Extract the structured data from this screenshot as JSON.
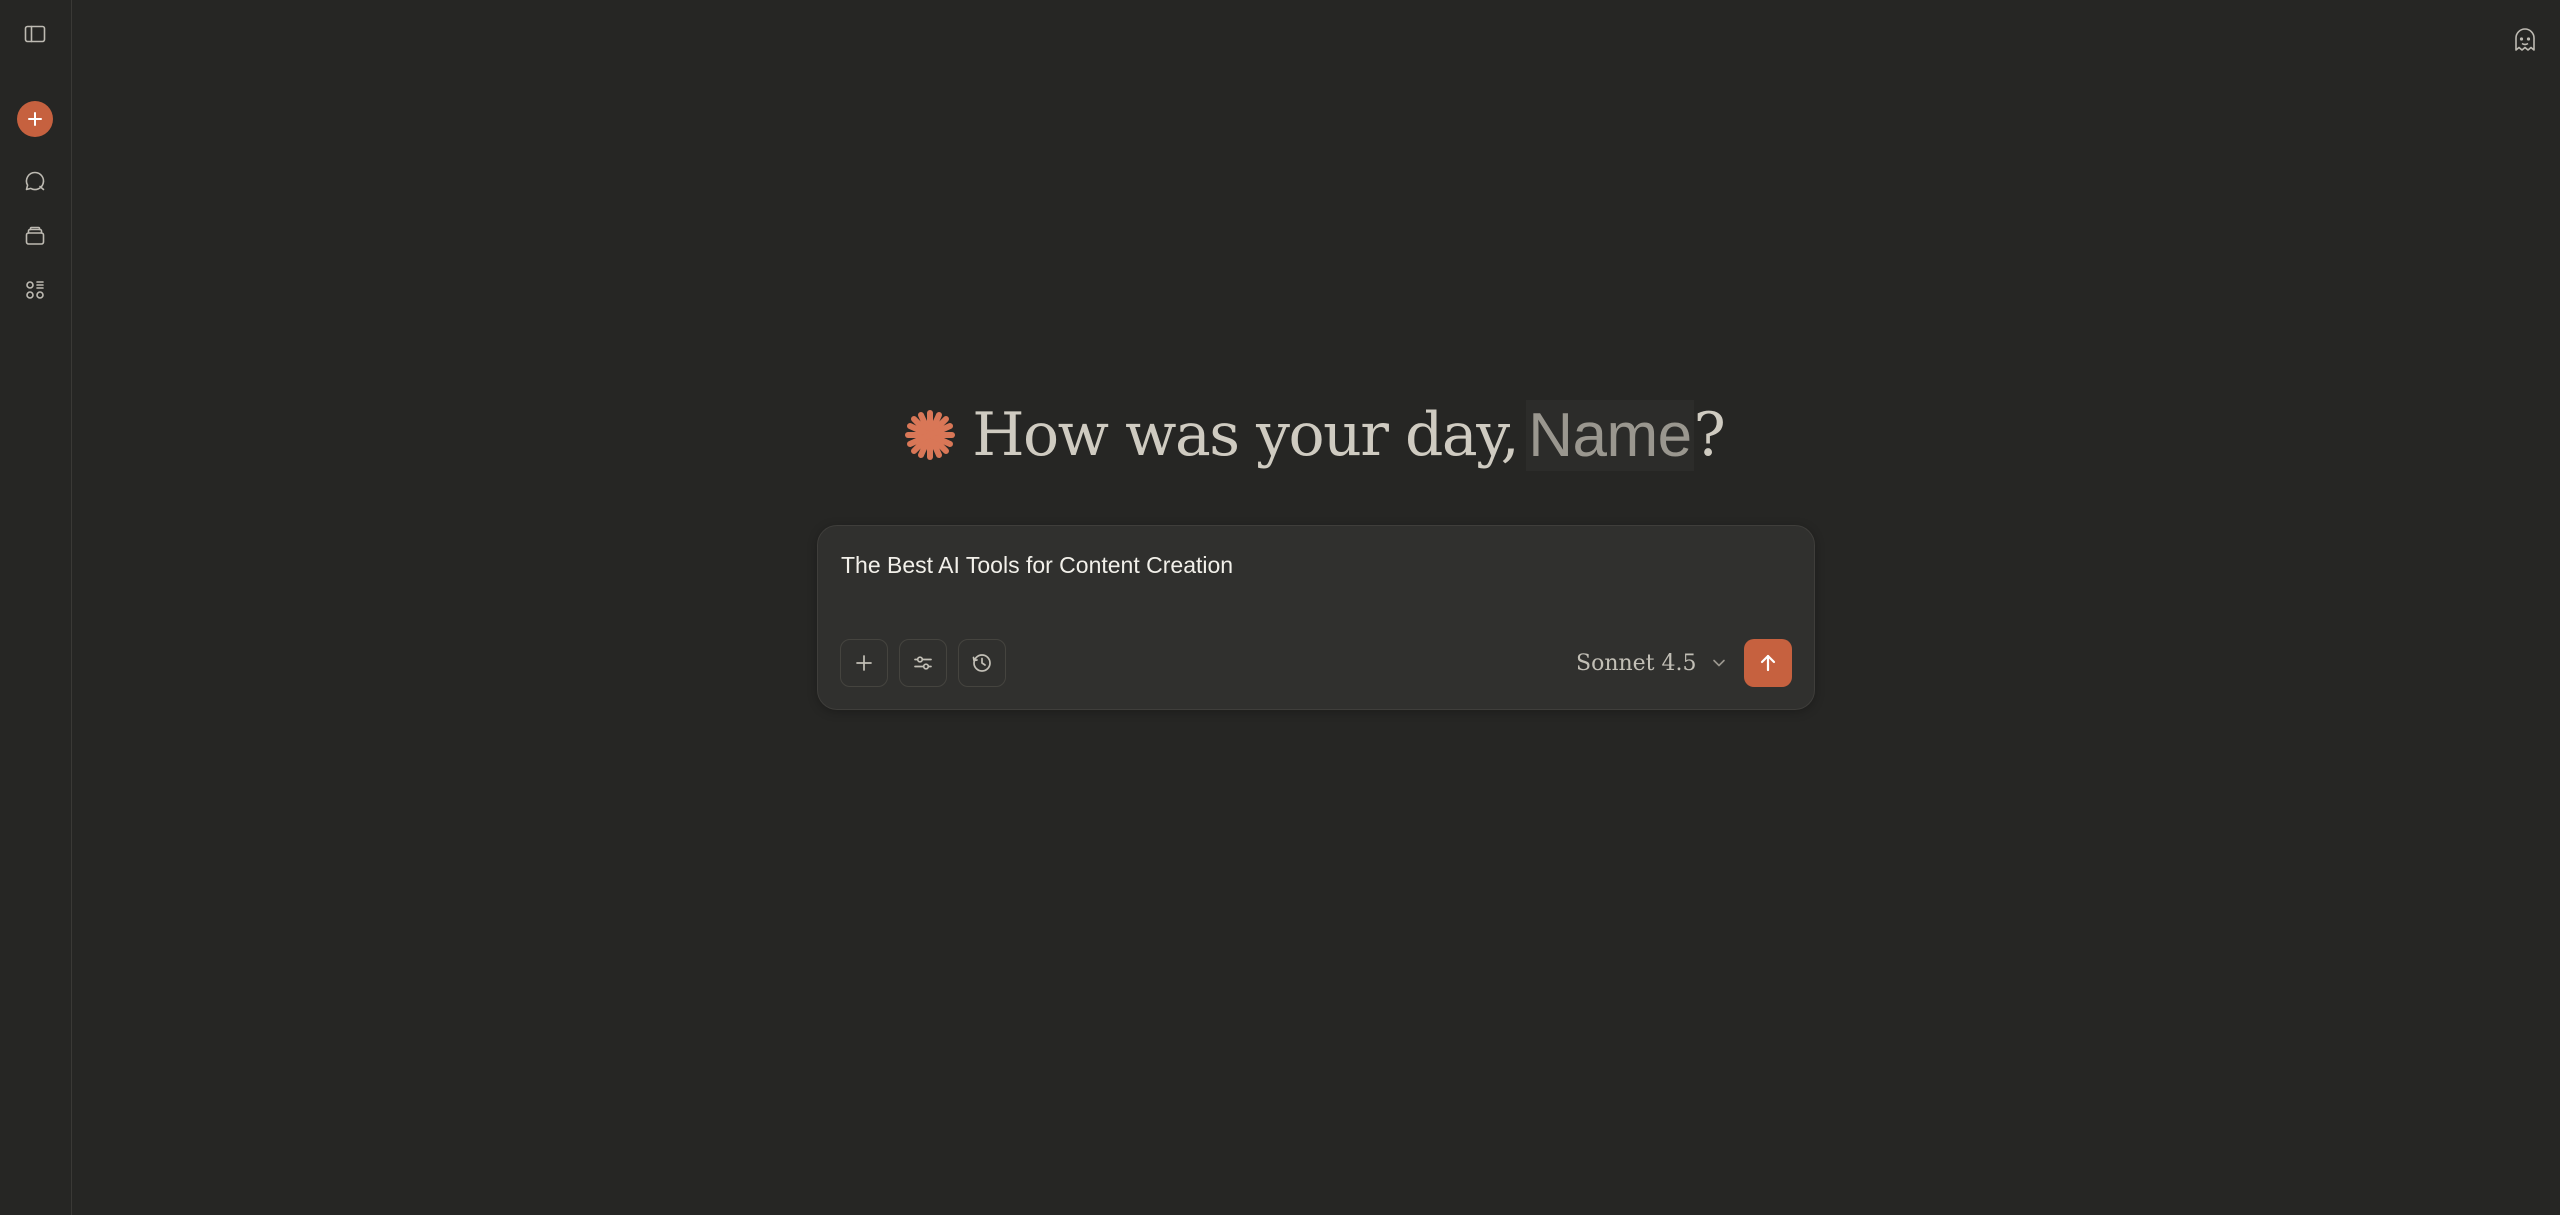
{
  "sidebar": {
    "items": [
      {
        "icon": "sidebar-toggle-icon"
      },
      {
        "icon": "plus-icon"
      },
      {
        "icon": "chat-bubble-icon"
      },
      {
        "icon": "projects-stack-icon"
      },
      {
        "icon": "artifacts-grid-icon"
      }
    ]
  },
  "header": {
    "incognito_icon": "ghost-icon"
  },
  "greeting": {
    "text": "How was your day,",
    "name": "Name",
    "suffix": "?",
    "icon": "spark-icon"
  },
  "composer": {
    "prompt": "The Best AI Tools for Content Creation",
    "model": "Sonnet 4.5",
    "tools": [
      "plus-icon",
      "sliders-icon",
      "clock-icon"
    ],
    "send_icon": "arrow-up-icon"
  },
  "colors": {
    "background": "#262624",
    "accent": "#c6613f",
    "spark": "#d97757",
    "composer_bg": "#30302e"
  }
}
